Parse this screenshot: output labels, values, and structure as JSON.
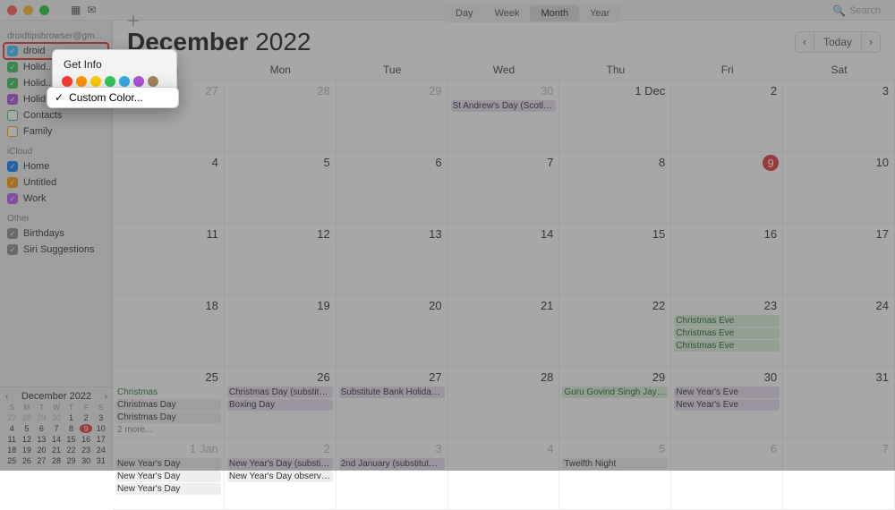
{
  "sidebar": {
    "accounts_label": "droidtipsbrowser@gm...",
    "selected_cal": "droid",
    "gmail_items": [
      {
        "label": "Holid...",
        "color": "#34c759"
      },
      {
        "label": "Holid...",
        "color": "#34c759"
      },
      {
        "label": "Holid...",
        "color": "#af52de"
      },
      {
        "label": "Contacts",
        "color": "#34c759",
        "unchecked": true
      },
      {
        "label": "Family",
        "color": "#ff9f0a",
        "unchecked": true
      }
    ],
    "icloud_label": "iCloud",
    "icloud_items": [
      {
        "label": "Home",
        "color": "#0a84ff"
      },
      {
        "label": "Untitled",
        "color": "#ff9f0a"
      },
      {
        "label": "Work",
        "color": "#bf5af2"
      }
    ],
    "other_label": "Other",
    "other_items": [
      {
        "label": "Birthdays",
        "color": "#8e8e93"
      },
      {
        "label": "Siri Suggestions",
        "color": "#8e8e93"
      }
    ]
  },
  "ctx_menu": {
    "get_info": "Get Info",
    "colors": [
      "#ff3b30",
      "#ff9500",
      "#ffcc00",
      "#34c759",
      "#32ade6",
      "#af52de",
      "#a2845e"
    ],
    "custom_color": "Custom Color..."
  },
  "toolbar": {
    "views": [
      "Day",
      "Week",
      "Month",
      "Year"
    ],
    "active_view": "Month",
    "search_placeholder": "Search",
    "today_label": "Today"
  },
  "month_title": {
    "month": "December",
    "year": "2022"
  },
  "dow": [
    "Sun",
    "Mon",
    "Tue",
    "Wed",
    "Thu",
    "Fri",
    "Sat"
  ],
  "cells": [
    {
      "n": "27",
      "out": true
    },
    {
      "n": "28",
      "out": true
    },
    {
      "n": "29",
      "out": true
    },
    {
      "n": "30",
      "out": true,
      "events": [
        {
          "t": "St Andrew's Day (Scotlan...",
          "c": "purple"
        }
      ]
    },
    {
      "n": "1 Dec"
    },
    {
      "n": "2"
    },
    {
      "n": "3"
    },
    {
      "n": "4"
    },
    {
      "n": "5"
    },
    {
      "n": "6"
    },
    {
      "n": "7"
    },
    {
      "n": "8"
    },
    {
      "n": "9",
      "today": true
    },
    {
      "n": "10"
    },
    {
      "n": "11"
    },
    {
      "n": "12"
    },
    {
      "n": "13"
    },
    {
      "n": "14"
    },
    {
      "n": "15"
    },
    {
      "n": "16"
    },
    {
      "n": "17"
    },
    {
      "n": "18"
    },
    {
      "n": "19"
    },
    {
      "n": "20"
    },
    {
      "n": "21"
    },
    {
      "n": "22"
    },
    {
      "n": "23",
      "events": [
        {
          "t": "Christmas Eve",
          "c": "green"
        },
        {
          "t": "Christmas Eve",
          "c": "green"
        },
        {
          "t": "Christmas Eve",
          "c": "green"
        }
      ]
    },
    {
      "n": "24"
    },
    {
      "n": "25",
      "events": [
        {
          "t": "Christmas",
          "c": "greentxt"
        },
        {
          "t": "Christmas Day",
          "c": "grey"
        },
        {
          "t": "Christmas Day",
          "c": "grey"
        },
        {
          "t": "2 more...",
          "c": "more"
        }
      ]
    },
    {
      "n": "26",
      "events": [
        {
          "t": "Christmas Day (substitute)",
          "c": "purple"
        },
        {
          "t": "Boxing Day",
          "c": "purple"
        }
      ]
    },
    {
      "n": "27",
      "events": [
        {
          "t": "Substitute Bank Holiday f...",
          "c": "purple"
        }
      ]
    },
    {
      "n": "28"
    },
    {
      "n": "29",
      "events": [
        {
          "t": "Guru Govind Singh Jayanti",
          "c": "green"
        }
      ]
    },
    {
      "n": "30",
      "events": [
        {
          "t": "New Year's Eve",
          "c": "purple"
        },
        {
          "t": "New Year's Eve",
          "c": "purple"
        }
      ]
    },
    {
      "n": "31"
    },
    {
      "n": "1 Jan",
      "out": true,
      "events": [
        {
          "t": "New Year's Day",
          "c": "grey"
        },
        {
          "t": "New Year's Day",
          "c": "grey"
        },
        {
          "t": "New Year's Day",
          "c": "grey"
        }
      ]
    },
    {
      "n": "2",
      "out": true,
      "events": [
        {
          "t": "New Year's Day (substitu...",
          "c": "purple"
        },
        {
          "t": "New Year's Day observed",
          "c": "grey"
        }
      ]
    },
    {
      "n": "3",
      "out": true,
      "events": [
        {
          "t": "2nd January (substitute d...",
          "c": "purple"
        }
      ]
    },
    {
      "n": "4",
      "out": true
    },
    {
      "n": "5",
      "out": true,
      "events": [
        {
          "t": "Twelfth Night",
          "c": "grey"
        }
      ]
    },
    {
      "n": "6",
      "out": true
    },
    {
      "n": "7",
      "out": true
    }
  ],
  "mini": {
    "title": "December 2022",
    "dow": [
      "S",
      "M",
      "T",
      "W",
      "T",
      "F",
      "S"
    ],
    "rows": [
      [
        {
          "n": "27",
          "d": true
        },
        {
          "n": "28",
          "d": true
        },
        {
          "n": "29",
          "d": true
        },
        {
          "n": "30",
          "d": true
        },
        {
          "n": "1"
        },
        {
          "n": "2"
        },
        {
          "n": "3"
        }
      ],
      [
        {
          "n": "4"
        },
        {
          "n": "5"
        },
        {
          "n": "6"
        },
        {
          "n": "7"
        },
        {
          "n": "8"
        },
        {
          "n": "9",
          "t": true
        },
        {
          "n": "10"
        }
      ],
      [
        {
          "n": "11"
        },
        {
          "n": "12"
        },
        {
          "n": "13"
        },
        {
          "n": "14"
        },
        {
          "n": "15"
        },
        {
          "n": "16"
        },
        {
          "n": "17"
        }
      ],
      [
        {
          "n": "18"
        },
        {
          "n": "19"
        },
        {
          "n": "20"
        },
        {
          "n": "21"
        },
        {
          "n": "22"
        },
        {
          "n": "23"
        },
        {
          "n": "24"
        }
      ],
      [
        {
          "n": "25"
        },
        {
          "n": "26"
        },
        {
          "n": "27"
        },
        {
          "n": "28"
        },
        {
          "n": "29"
        },
        {
          "n": "30"
        },
        {
          "n": "31"
        }
      ]
    ]
  }
}
